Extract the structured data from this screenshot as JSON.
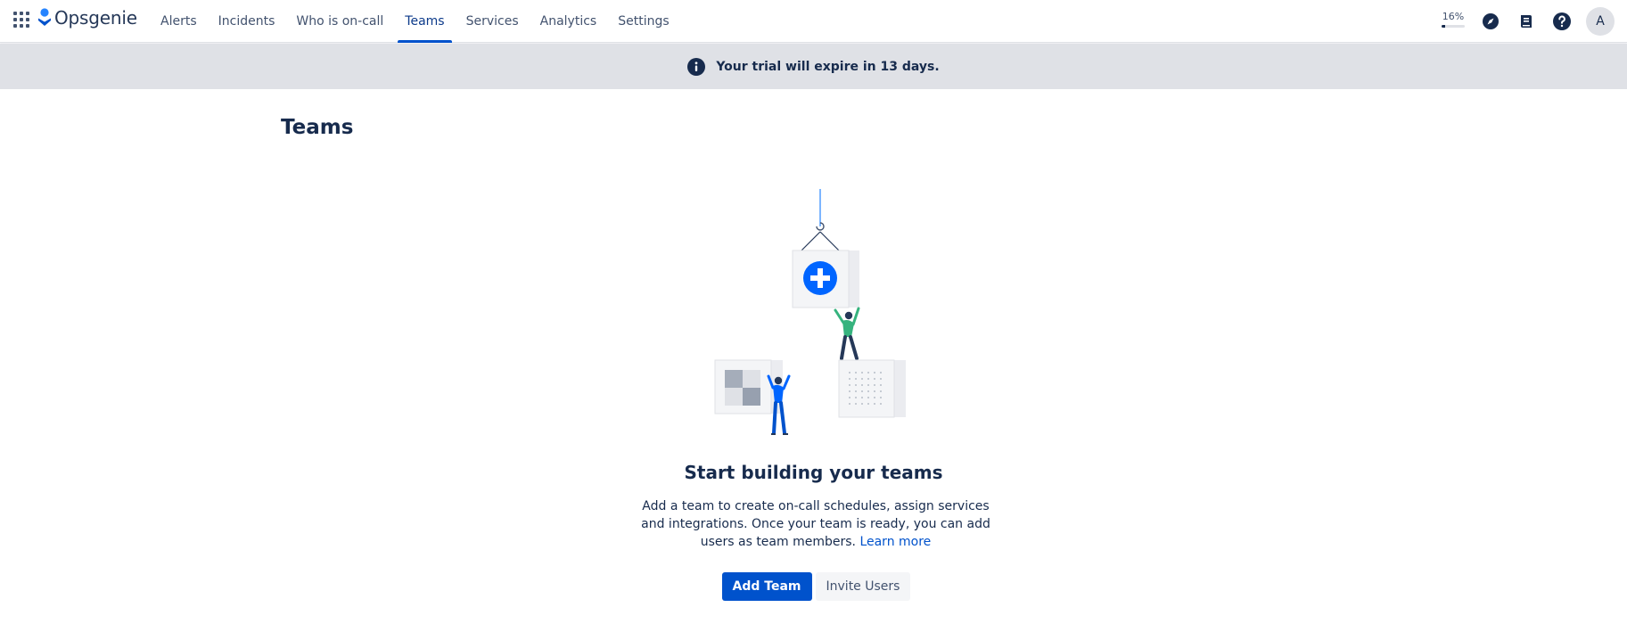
{
  "app": {
    "name": "Opsgenie",
    "brand_color": "#0052cc"
  },
  "nav": {
    "items": [
      {
        "label": "Alerts",
        "active": false
      },
      {
        "label": "Incidents",
        "active": false
      },
      {
        "label": "Who is on-call",
        "active": false
      },
      {
        "label": "Teams",
        "active": true
      },
      {
        "label": "Services",
        "active": false
      },
      {
        "label": "Analytics",
        "active": false
      },
      {
        "label": "Settings",
        "active": false
      }
    ]
  },
  "toolbar": {
    "progress_label": "16%",
    "progress_value": 0.16,
    "icons": [
      "compass-icon",
      "book-icon",
      "help-icon"
    ],
    "avatar_initial": "A"
  },
  "banner": {
    "icon": "info-icon",
    "text": "Your trial will expire in 13 days."
  },
  "page": {
    "title": "Teams"
  },
  "empty_state": {
    "illustration": "team-building-illustration",
    "title": "Start building your teams",
    "description": "Add a team to create on-call schedules, assign services and integrations. Once your team is ready, you can add users as team members.",
    "learn_more": "Learn more",
    "primary_button": "Add Team",
    "secondary_button": "Invite Users"
  }
}
